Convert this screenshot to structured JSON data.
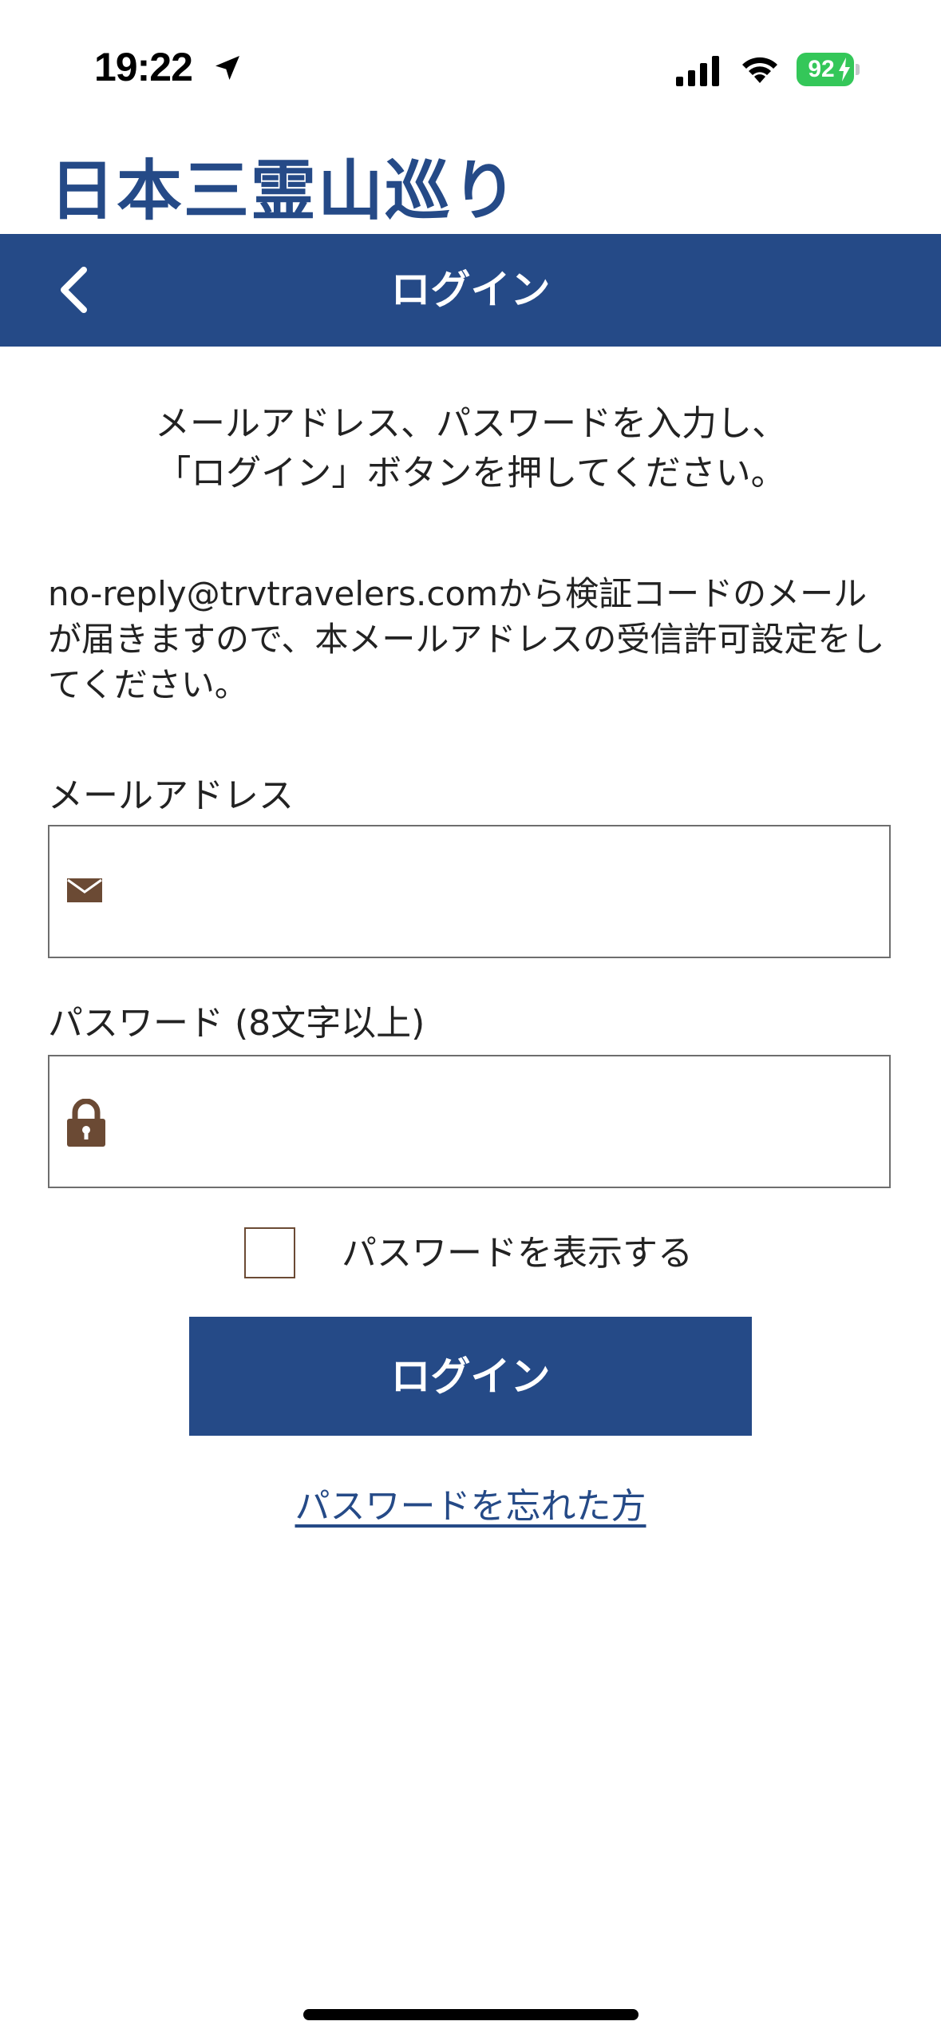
{
  "status_bar": {
    "time": "19:22",
    "battery": "92",
    "location_icon": "location-arrow-icon",
    "signal_icon": "cellular-signal-icon",
    "wifi_icon": "wifi-icon",
    "battery_color": "#34c759"
  },
  "app": {
    "title": "日本三霊山巡り",
    "brand_color": "#254a87"
  },
  "nav": {
    "title": "ログイン",
    "back_icon": "chevron-left-icon"
  },
  "instructions": {
    "line1": "メールアドレス、パスワードを入力し、",
    "line2": "「ログイン」ボタンを押してください。"
  },
  "notice": {
    "text": "no-reply@trvtravelers.comから検証コードのメールが届きますので、本メールアドレスの受信許可設定をしてください。"
  },
  "form": {
    "email": {
      "label": "メールアドレス",
      "value": "",
      "icon": "mail-icon"
    },
    "password": {
      "label": "パスワード (8文字以上)",
      "value": "",
      "icon": "lock-icon"
    },
    "show_password": {
      "label": "パスワードを表示する",
      "checked": false
    },
    "login_button": "ログイン",
    "forgot_link": "パスワードを忘れた方"
  },
  "colors": {
    "icon_brown": "#6b4a34",
    "border_gray": "#6e6e6e"
  }
}
